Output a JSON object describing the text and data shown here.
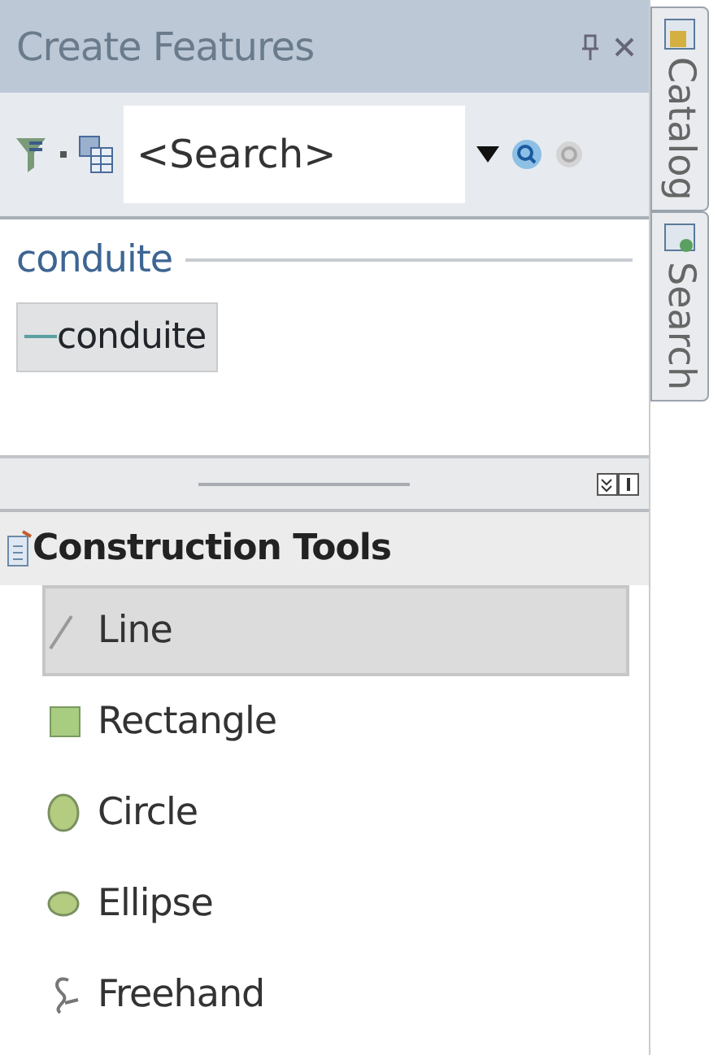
{
  "panel": {
    "title": "Create Features",
    "search": {
      "placeholder": "<Search>"
    },
    "template_groups": [
      {
        "name": "conduite",
        "templates": [
          {
            "label": "conduite",
            "selected": true
          }
        ]
      }
    ],
    "construction_tools": {
      "title": "Construction Tools",
      "tools": [
        {
          "label": "Line",
          "kind": "line",
          "selected": true
        },
        {
          "label": "Rectangle",
          "kind": "rectangle",
          "selected": false
        },
        {
          "label": "Circle",
          "kind": "circle",
          "selected": false
        },
        {
          "label": "Ellipse",
          "kind": "ellipse",
          "selected": false
        },
        {
          "label": "Freehand",
          "kind": "freehand",
          "selected": false
        }
      ]
    }
  },
  "side_tabs": [
    {
      "label": "Catalog",
      "kind": "catalog"
    },
    {
      "label": "Search",
      "kind": "search"
    }
  ]
}
